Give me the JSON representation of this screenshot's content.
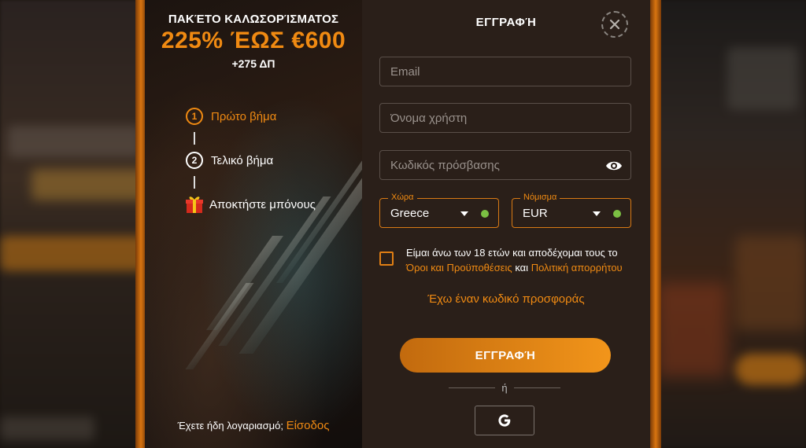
{
  "promo": {
    "kicker": "ΠΑΚΈΤΟ ΚΑΛΩΣΟΡΊΣΜΑΤΟΣ",
    "bonus": "225% ΈΩΣ €600",
    "extra": "+275 ΔΠ",
    "steps": [
      {
        "num": "1",
        "label": "Πρώτο βήμα",
        "active": true
      },
      {
        "num": "2",
        "label": "Τελικό βήμα",
        "active": false
      },
      {
        "label": "Αποκτήστε μπόνους",
        "icon": "gift-icon"
      }
    ],
    "login_prompt": "Έχετε ήδη λογαριασμό;",
    "login_link": "Είσοδος"
  },
  "form": {
    "title": "ΕΓΓΡΑΦΉ",
    "email_placeholder": "Email",
    "username_placeholder": "Όνομα χρήστη",
    "password_placeholder": "Κωδικός πρόσβασης",
    "country": {
      "label": "Χώρα",
      "value": "Greece"
    },
    "currency": {
      "label": "Νόμισμα",
      "value": "EUR"
    },
    "terms_text": "Είμαι άνω των 18 ετών και αποδέχομαι τους το",
    "terms_link": "Όροι και Προϋποθέσεις",
    "terms_and": "και",
    "privacy_link": "Πολιτική απορρήτου",
    "promo_code_link": "Έχω έναν κωδικό προσφοράς",
    "submit_label": "ΕΓΓΡΑΦΉ",
    "or_label": "ή",
    "google_label": "G"
  },
  "colors": {
    "accent": "#f08a12",
    "panel_bg": "#2a1f19",
    "ok_dot": "#7bc043"
  }
}
